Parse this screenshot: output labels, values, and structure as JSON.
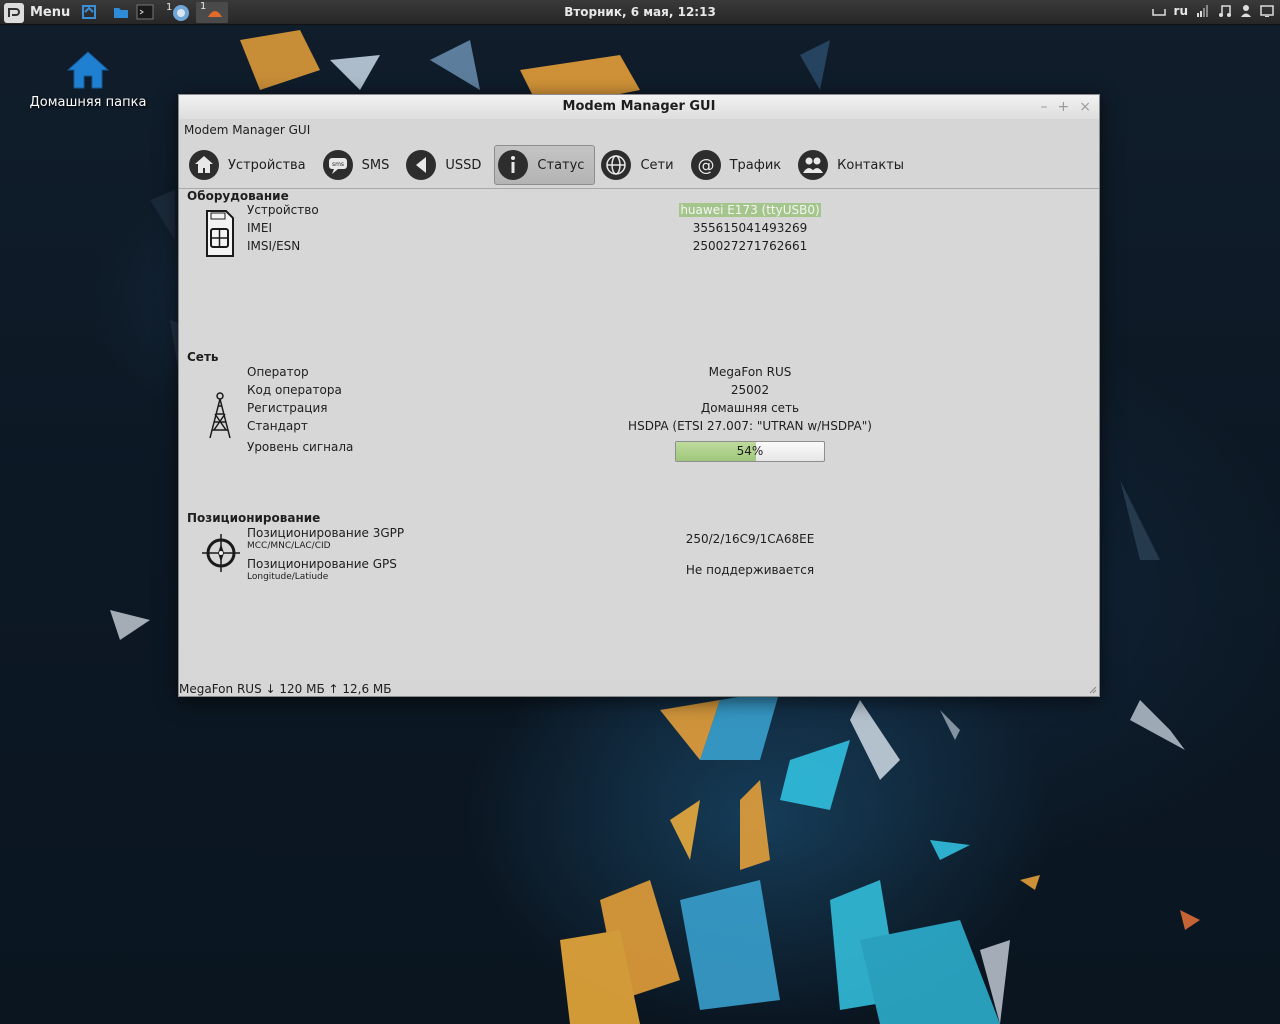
{
  "panel": {
    "menu_label": "Menu",
    "clock": "Вторник,  6 мая, 12:13",
    "workspace_1": "1",
    "workspace_2": "1",
    "keyboard_layout": "ru"
  },
  "desktop": {
    "home_folder_label": "Домашняя папка"
  },
  "window": {
    "title": "Modem Manager GUI",
    "menubar_label": "Modem Manager GUI",
    "controls": {
      "minimize": "–",
      "maximize": "+",
      "close": "×"
    },
    "toolbar": [
      {
        "id": "devices",
        "label": "Устройства",
        "icon": "home-icon",
        "active": false
      },
      {
        "id": "sms",
        "label": "SMS",
        "icon": "sms-icon",
        "active": false
      },
      {
        "id": "ussd",
        "label": "USSD",
        "icon": "ussd-icon",
        "active": false
      },
      {
        "id": "status",
        "label": "Статус",
        "icon": "info-icon",
        "active": true
      },
      {
        "id": "networks",
        "label": "Сети",
        "icon": "globe-icon",
        "active": false
      },
      {
        "id": "traffic",
        "label": "Трафик",
        "icon": "at-icon",
        "active": false
      },
      {
        "id": "contacts",
        "label": "Контакты",
        "icon": "contacts-icon",
        "active": false
      }
    ]
  },
  "status": {
    "hardware": {
      "title": "Оборудование",
      "device_label": "Устройство",
      "device_value": "huawei E173 (ttyUSB0)",
      "imei_label": "IMEI",
      "imei_value": "355615041493269",
      "imsi_label": "IMSI/ESN",
      "imsi_value": "250027271762661"
    },
    "network": {
      "title": "Сеть",
      "operator_label": "Оператор",
      "operator_value": "MegaFon RUS",
      "operator_code_label": "Код оператора",
      "operator_code_value": "25002",
      "registration_label": "Регистрация",
      "registration_value": "Домашняя сеть",
      "standard_label": "Стандарт",
      "standard_value": "HSDPA (ETSI 27.007: \"UTRAN w/HSDPA\")",
      "signal_label": "Уровень сигнала",
      "signal_text": "54%",
      "signal_percent": 54
    },
    "location": {
      "title": "Позиционирование",
      "gpp_label": "Позиционирование 3GPP",
      "gpp_sub": "MCC/MNC/LAC/CID",
      "gpp_value": "250/2/16C9/1CA68EE",
      "gps_label": "Позиционирование GPS",
      "gps_sub": "Longitude/Latiude",
      "gps_value": "Не поддерживается"
    }
  },
  "statusbar": {
    "text": "MegaFon RUS ↓ 120 МБ ↑ 12,6 МБ"
  },
  "colors": {
    "window_bg": "#d7d7d7",
    "signal_fill": "#a8cd86",
    "selection": "#a4c68c",
    "home_icon": "#1f7fd0"
  }
}
